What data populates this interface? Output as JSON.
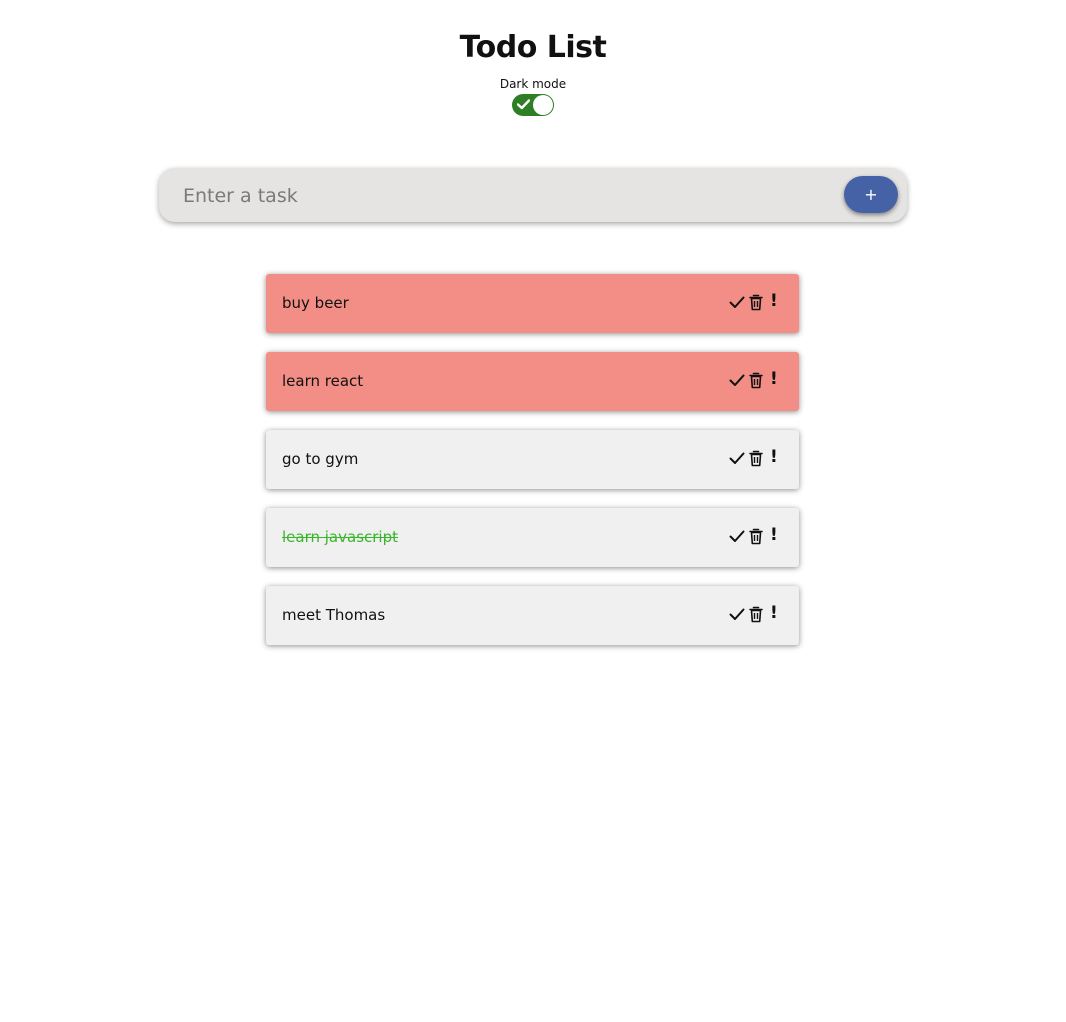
{
  "header": {
    "title": "Todo List",
    "dark_mode_label": "Dark mode",
    "dark_mode_enabled": true
  },
  "form": {
    "placeholder": "Enter a task",
    "add_label": "+"
  },
  "icons": {
    "toggle": "check-icon",
    "complete": "check-icon",
    "delete": "trash-icon",
    "important": "exclamation-icon",
    "important_glyph": "!"
  },
  "colors": {
    "important_bg": "#f28e85",
    "normal_bg": "#f0f0f0",
    "done_text": "#38b52a",
    "add_button": "#4662a6",
    "toggle_on": "#2f7d24"
  },
  "todos": [
    {
      "text": "buy beer",
      "important": true,
      "done": false
    },
    {
      "text": "learn react",
      "important": true,
      "done": false
    },
    {
      "text": "go to gym",
      "important": false,
      "done": false
    },
    {
      "text": "learn javascript",
      "important": false,
      "done": true
    },
    {
      "text": "meet Thomas",
      "important": false,
      "done": false
    }
  ]
}
